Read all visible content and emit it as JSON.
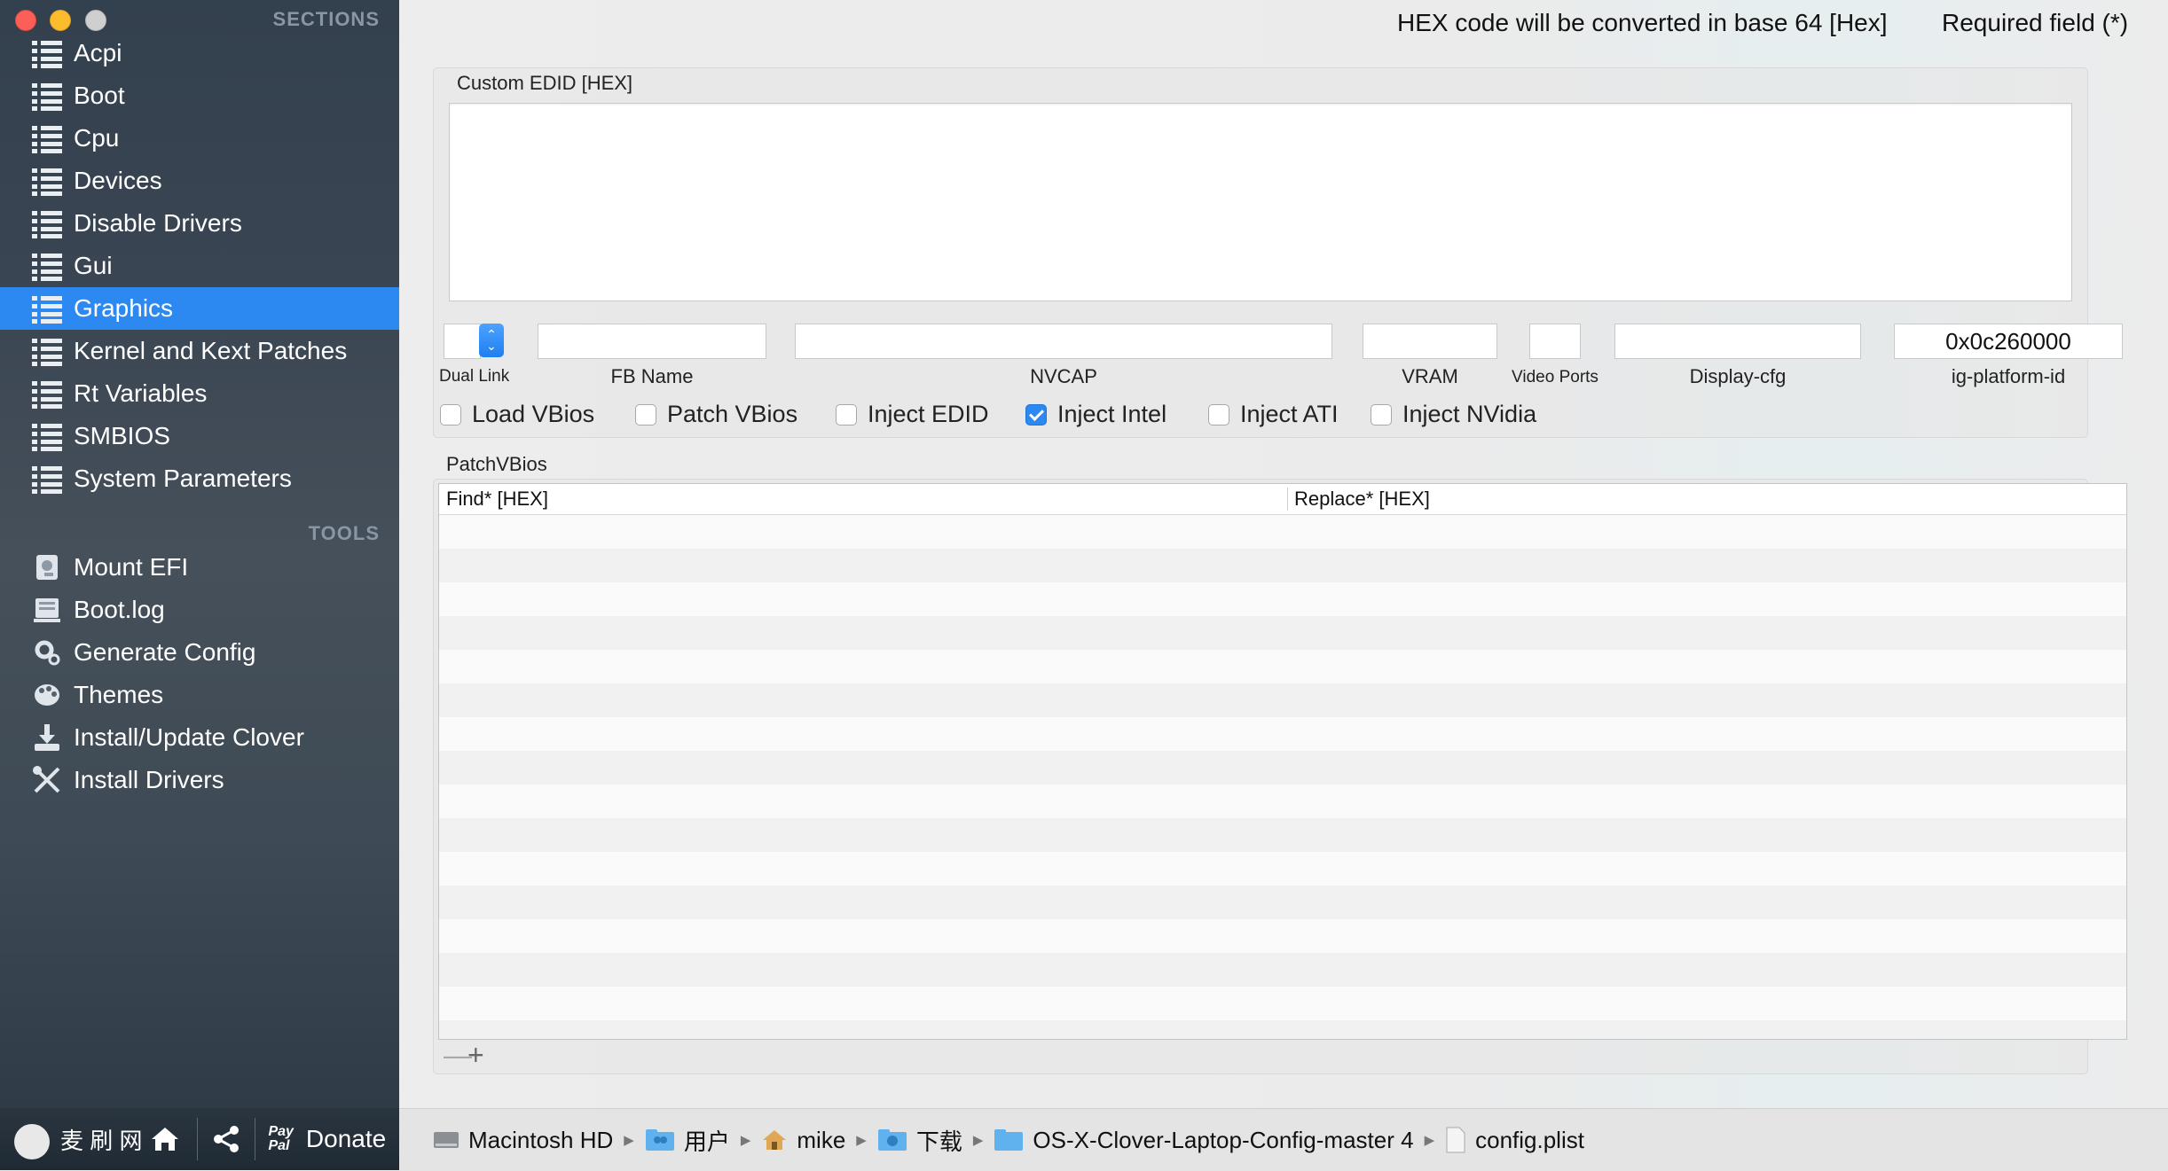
{
  "window": {
    "sidebar": {
      "sections_header": "SECTIONS",
      "sections": [
        "Acpi",
        "Boot",
        "Cpu",
        "Devices",
        "Disable Drivers",
        "Gui",
        "Graphics",
        "Kernel and Kext Patches",
        "Rt Variables",
        "SMBIOS",
        "System Parameters"
      ],
      "active_section": "Graphics",
      "tools_header": "TOOLS",
      "tools": [
        {
          "label": "Mount EFI",
          "icon": "disk-icon"
        },
        {
          "label": "Boot.log",
          "icon": "log-icon"
        },
        {
          "label": "Generate Config",
          "icon": "gear-icon"
        },
        {
          "label": "Themes",
          "icon": "palette-icon"
        },
        {
          "label": "Install/Update Clover",
          "icon": "download-icon"
        },
        {
          "label": "Install Drivers",
          "icon": "tools-icon"
        }
      ],
      "bottom": {
        "donate_label": "Donate",
        "paypal_label": "Pay\nPal",
        "watermark": "麦 刷 网",
        "watermark_url": "www.MeMacX.com"
      }
    }
  },
  "header": {
    "hex_note": "HEX code will be converted in base 64 [Hex]",
    "required_note": "Required field (*)"
  },
  "graphics": {
    "custom_edid_title": "Custom EDID [HEX]",
    "custom_edid_value": "",
    "fields": {
      "dual_link": {
        "label": "Dual Link",
        "value": ""
      },
      "fb_name": {
        "label": "FB Name",
        "value": ""
      },
      "nvcap": {
        "label": "NVCAP",
        "value": ""
      },
      "vram": {
        "label": "VRAM",
        "value": ""
      },
      "video_ports": {
        "label": "Video Ports",
        "value": ""
      },
      "display_cfg": {
        "label": "Display-cfg",
        "value": ""
      },
      "ig_platform_id": {
        "label": "ig-platform-id",
        "value": "0x0c260000"
      }
    },
    "checkboxes": [
      {
        "label": "Load VBios",
        "checked": false
      },
      {
        "label": "Patch VBios",
        "checked": false
      },
      {
        "label": "Inject EDID",
        "checked": false
      },
      {
        "label": "Inject Intel",
        "checked": true
      },
      {
        "label": "Inject ATI",
        "checked": false
      },
      {
        "label": "Inject NVidia",
        "checked": false
      }
    ],
    "patch_vbios": {
      "title": "PatchVBios",
      "columns": [
        "Find* [HEX]",
        "Replace* [HEX]"
      ],
      "rows": []
    },
    "add_remove": {
      "remove": "—",
      "add": "+"
    }
  },
  "pathbar": [
    {
      "label": "Macintosh HD",
      "icon": "hard-drive-icon"
    },
    {
      "label": "用户",
      "icon": "users-folder-icon"
    },
    {
      "label": "mike",
      "icon": "home-icon"
    },
    {
      "label": "下载",
      "icon": "downloads-folder-icon"
    },
    {
      "label": "OS-X-Clover-Laptop-Config-master 4",
      "icon": "folder-icon"
    },
    {
      "label": "config.plist",
      "icon": "file-icon"
    }
  ]
}
